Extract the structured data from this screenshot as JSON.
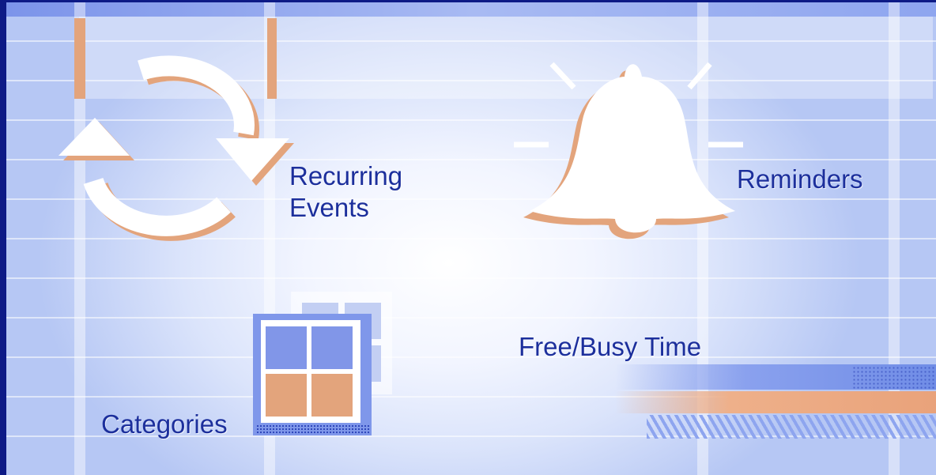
{
  "features": {
    "recurring_line1": "Recurring",
    "recurring_line2": "Events",
    "reminders": "Reminders",
    "free_busy": "Free/Busy Time",
    "categories": "Categories"
  },
  "colors": {
    "background_light": "#ffffff",
    "background_blue": "#b6c7f4",
    "frame": "#0d1a86",
    "label_text": "#1c2f9c",
    "accent_peach": "#e3a47c",
    "accent_blue": "#7f97ea"
  },
  "icons": {
    "recurring": "circular-arrows-icon",
    "reminders": "bell-icon",
    "categories": "category-grid-icon",
    "free_busy": "time-bars-graphic"
  }
}
